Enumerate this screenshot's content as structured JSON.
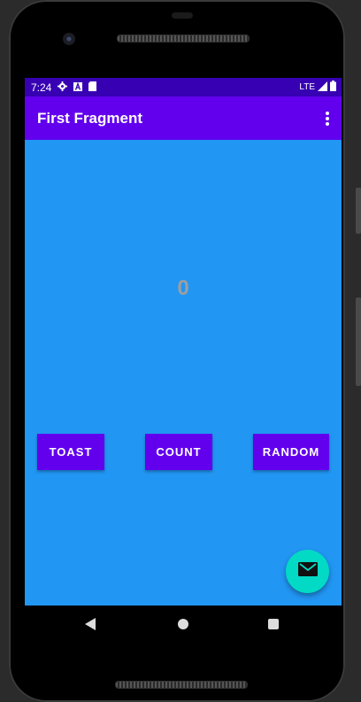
{
  "status_bar": {
    "time": "7:24",
    "network": "LTE",
    "icons": [
      "gear-icon",
      "a-icon",
      "sd-card-icon",
      "signal-icon",
      "battery-icon"
    ]
  },
  "app_bar": {
    "title": "First Fragment",
    "overflow_icon": "more-vert-icon"
  },
  "content": {
    "count_value": "0",
    "buttons": {
      "toast": "TOAST",
      "count": "COUNT",
      "random": "RANDOM"
    },
    "fab_icon": "email-icon"
  },
  "nav_bar": {
    "icons": [
      "back-icon",
      "home-icon",
      "recents-icon"
    ]
  },
  "colors": {
    "primary": "#6200ee",
    "primary_dark": "#3700b3",
    "background": "#2196f3",
    "accent": "#03dac5",
    "count_text": "#9e9e9e"
  }
}
